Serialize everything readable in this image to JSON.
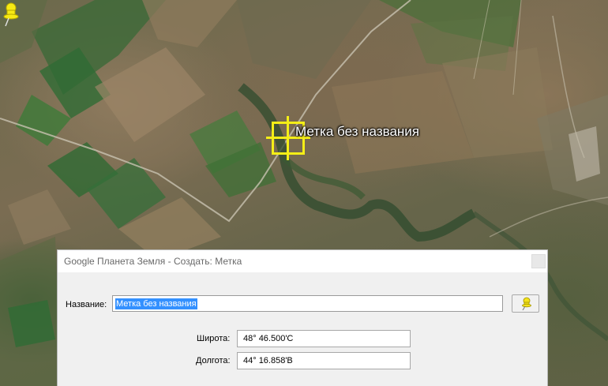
{
  "map": {
    "placemark_label": "Метка без названия",
    "placemark_color": "#f4ee17"
  },
  "dialog": {
    "title": "Google Планета Земля - Создать: Метка",
    "name_label": "Название:",
    "name_value": "Метка без названия",
    "placemark_icon_button": "pushpin-icon",
    "latitude_label": "Широта:",
    "latitude_value": "48° 46.500'С",
    "longitude_label": "Долгота:",
    "longitude_value": "44° 16.858'В"
  }
}
